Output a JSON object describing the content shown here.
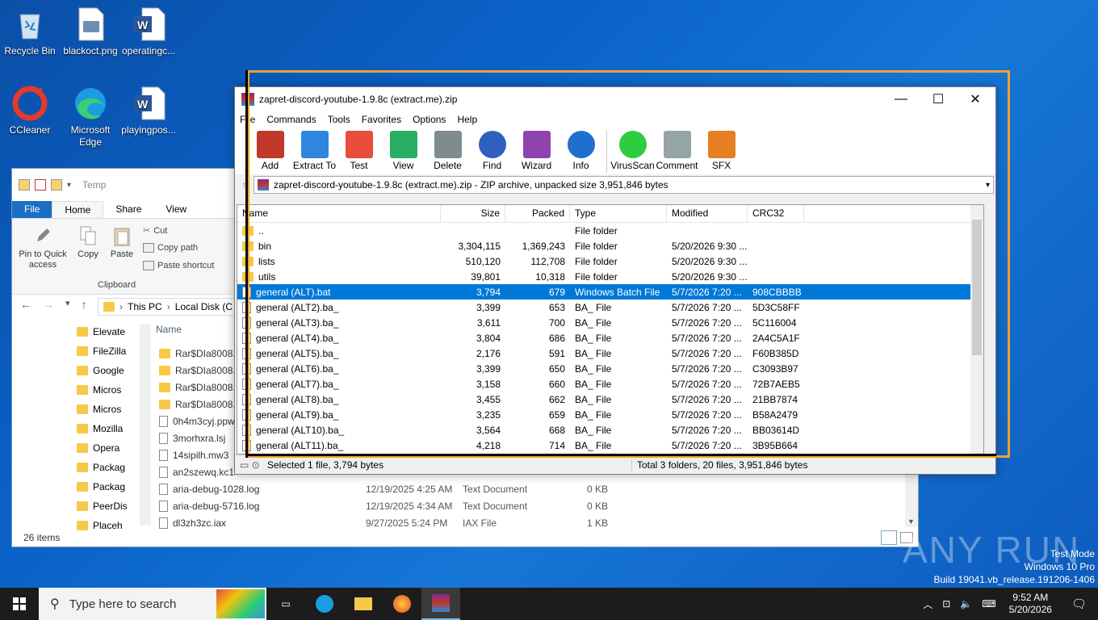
{
  "desktop": {
    "icons": [
      {
        "label": "Recycle Bin",
        "icon": "recycle-bin-icon"
      },
      {
        "label": "blackoct.png",
        "icon": "image-file-icon"
      },
      {
        "label": "operatingc...",
        "icon": "word-doc-icon"
      },
      {
        "label": "CCleaner",
        "icon": "ccleaner-icon"
      },
      {
        "label": "Microsoft Edge",
        "icon": "edge-icon"
      },
      {
        "label": "playingpos...",
        "icon": "word-doc-icon"
      }
    ],
    "watermark": {
      "text": "ANY RUN",
      "test_mode": "Test Mode",
      "os": "Windows 10 Pro",
      "build": "Build 19041.vb_release.191206-1406"
    }
  },
  "explorer": {
    "title": "Temp",
    "tabs": [
      "File",
      "Home",
      "Share",
      "View"
    ],
    "ribbon": {
      "pin": "Pin to Quick access",
      "copy": "Copy",
      "paste": "Paste",
      "cut": "Cut",
      "copy_path": "Copy path",
      "paste_shortcut": "Paste shortcut",
      "group": "Clipboard"
    },
    "breadcrumb": [
      "This PC",
      "Local Disk (C"
    ],
    "nav": [
      "Elevate",
      "FileZilla",
      "Google",
      "Micros",
      "Micros",
      "Mozilla",
      "Opera",
      "Packag",
      "Packag",
      "PeerDis",
      "Placeh"
    ],
    "column_name": "Name",
    "files": [
      {
        "name": "Rar$DIa8008.17",
        "date": "",
        "type": "",
        "size": "",
        "folder": true
      },
      {
        "name": "Rar$DIa8008.18",
        "date": "",
        "type": "",
        "size": "",
        "folder": true
      },
      {
        "name": "Rar$DIa8008.22",
        "date": "",
        "type": "",
        "size": "",
        "folder": true
      },
      {
        "name": "Rar$DIa8008.27",
        "date": "",
        "type": "",
        "size": "",
        "folder": true
      },
      {
        "name": "0h4m3cyj.ppw",
        "date": "",
        "type": "",
        "size": "",
        "folder": false
      },
      {
        "name": "3morhxra.lsj",
        "date": "",
        "type": "",
        "size": "",
        "folder": false
      },
      {
        "name": "14sipilh.mw3",
        "date": "",
        "type": "",
        "size": "",
        "folder": false
      },
      {
        "name": "an2szewq.kc1",
        "date": "",
        "type": "",
        "size": "",
        "folder": false
      },
      {
        "name": "aria-debug-1028.log",
        "date": "12/19/2025 4:25 AM",
        "type": "Text Document",
        "size": "0 KB",
        "folder": false
      },
      {
        "name": "aria-debug-5716.log",
        "date": "12/19/2025 4:34 AM",
        "type": "Text Document",
        "size": "0 KB",
        "folder": false
      },
      {
        "name": "dl3zh3zc.iax",
        "date": "9/27/2025 5:24 PM",
        "type": "IAX File",
        "size": "1 KB",
        "folder": false
      }
    ],
    "status": "26 items"
  },
  "winrar": {
    "title": "zapret-discord-youtube-1.9.8c (extract.me).zip",
    "menu": [
      "File",
      "Commands",
      "Tools",
      "Favorites",
      "Options",
      "Help"
    ],
    "toolbar": [
      {
        "label": "Add",
        "color": "#c0392b"
      },
      {
        "label": "Extract To",
        "color": "#2e86de"
      },
      {
        "label": "Test",
        "color": "#e74c3c"
      },
      {
        "label": "View",
        "color": "#27ae60"
      },
      {
        "label": "Delete",
        "color": "#7f8c8d"
      },
      {
        "label": "Find",
        "color": "#2f5fbf"
      },
      {
        "label": "Wizard",
        "color": "#8e44ad"
      },
      {
        "label": "Info",
        "color": "#1f6fd1"
      },
      {
        "label": "VirusScan",
        "color": "#2ecc40"
      },
      {
        "label": "Comment",
        "color": "#95a5a6"
      },
      {
        "label": "SFX",
        "color": "#e67e22"
      }
    ],
    "path": "zapret-discord-youtube-1.9.8c (extract.me).zip - ZIP archive, unpacked size 3,951,846 bytes",
    "columns": [
      "Name",
      "Size",
      "Packed",
      "Type",
      "Modified",
      "CRC32"
    ],
    "rows": [
      {
        "name": "..",
        "size": "",
        "packed": "",
        "type": "File folder",
        "modified": "",
        "crc": "",
        "selected": false
      },
      {
        "name": "bin",
        "size": "3,304,115",
        "packed": "1,369,243",
        "type": "File folder",
        "modified": "5/20/2026 9:30 ...",
        "crc": "",
        "selected": false
      },
      {
        "name": "lists",
        "size": "510,120",
        "packed": "112,708",
        "type": "File folder",
        "modified": "5/20/2026 9:30 ...",
        "crc": "",
        "selected": false
      },
      {
        "name": "utils",
        "size": "39,801",
        "packed": "10,318",
        "type": "File folder",
        "modified": "5/20/2026 9:30 ...",
        "crc": "",
        "selected": false
      },
      {
        "name": "general (ALT).bat",
        "size": "3,794",
        "packed": "679",
        "type": "Windows Batch File",
        "modified": "5/7/2026 7:20 ...",
        "crc": "908CBBBB",
        "selected": true
      },
      {
        "name": "general (ALT2).ba_",
        "size": "3,399",
        "packed": "653",
        "type": "BA_ File",
        "modified": "5/7/2026 7:20 ...",
        "crc": "5D3C58FF",
        "selected": false
      },
      {
        "name": "general (ALT3).ba_",
        "size": "3,611",
        "packed": "700",
        "type": "BA_ File",
        "modified": "5/7/2026 7:20 ...",
        "crc": "5C116004",
        "selected": false
      },
      {
        "name": "general (ALT4).ba_",
        "size": "3,804",
        "packed": "686",
        "type": "BA_ File",
        "modified": "5/7/2026 7:20 ...",
        "crc": "2A4C5A1F",
        "selected": false
      },
      {
        "name": "general (ALT5).ba_",
        "size": "2,176",
        "packed": "591",
        "type": "BA_ File",
        "modified": "5/7/2026 7:20 ...",
        "crc": "F60B385D",
        "selected": false
      },
      {
        "name": "general (ALT6).ba_",
        "size": "3,399",
        "packed": "650",
        "type": "BA_ File",
        "modified": "5/7/2026 7:20 ...",
        "crc": "C3093B97",
        "selected": false
      },
      {
        "name": "general (ALT7).ba_",
        "size": "3,158",
        "packed": "660",
        "type": "BA_ File",
        "modified": "5/7/2026 7:20 ...",
        "crc": "72B7AEB5",
        "selected": false
      },
      {
        "name": "general (ALT8).ba_",
        "size": "3,455",
        "packed": "662",
        "type": "BA_ File",
        "modified": "5/7/2026 7:20 ...",
        "crc": "21BB7874",
        "selected": false
      },
      {
        "name": "general (ALT9).ba_",
        "size": "3,235",
        "packed": "659",
        "type": "BA_ File",
        "modified": "5/7/2026 7:20 ...",
        "crc": "B58A2479",
        "selected": false
      },
      {
        "name": "general (ALT10).ba_",
        "size": "3,564",
        "packed": "668",
        "type": "BA_ File",
        "modified": "5/7/2026 7:20 ...",
        "crc": "BB03614D",
        "selected": false
      },
      {
        "name": "general (ALT11).ba_",
        "size": "4,218",
        "packed": "714",
        "type": "BA_ File",
        "modified": "5/7/2026 7:20 ...",
        "crc": "3B95B664",
        "selected": false
      }
    ],
    "status_left": "Selected 1 file, 3,794 bytes",
    "status_right": "Total 3 folders, 20 files, 3,951,846 bytes"
  },
  "taskbar": {
    "search_placeholder": "Type here to search",
    "time": "9:52 AM",
    "date": "5/20/2026"
  },
  "colors": {
    "selection": "#0078d7",
    "highlight_frame": "#f0a030",
    "taskbar": "#1c1c1c"
  }
}
